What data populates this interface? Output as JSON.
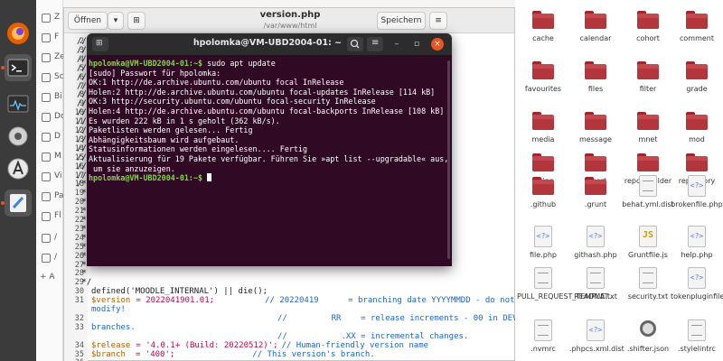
{
  "gedit": {
    "open_label": "Öffnen",
    "save_label": "Speichern",
    "title": "version.php",
    "subtitle": "/var/www/html"
  },
  "sidebar_left": {
    "items": [
      "Z",
      "F",
      "Ze",
      "Sc",
      "Bi",
      "Do",
      "D",
      "M",
      "Vi",
      "Pa",
      "Fl",
      "/",
      "/",
      "+ A"
    ]
  },
  "code": {
    "line_numbers": [
      "2",
      "3",
      "4",
      "5",
      "6",
      "7",
      "8",
      "9",
      "10",
      "11",
      "12",
      "13",
      "14",
      "15",
      "16",
      "17",
      "18",
      "19",
      "20",
      "21",
      "22",
      "23",
      "24",
      "25",
      "26",
      "27",
      "28",
      "29",
      "30",
      "31",
      "",
      "32",
      "33",
      "",
      "34",
      "35",
      "36"
    ],
    "partial_lines": [
      "//",
      "//",
      "//",
      "//",
      "//",
      "//",
      "//",
      "//",
      "//",
      "//",
      "//",
      "//",
      "//",
      "//",
      "//",
      "//",
      "/**",
      " *",
      " *",
      " *",
      " *",
      " *",
      " *",
      " *",
      " *",
      " *",
      " *",
      " */"
    ],
    "l30": "defined('MOODLE_INTERNAL') || die();",
    "l31_var": "$version",
    "l31_val": "= 2022041901.01;",
    "l31_com": "// 20220419      = branching date YYYYMMDD - do not",
    "l31b_com": "modify!",
    "l32_com": "//         RR    = release increments - 00 in DEV",
    "l32b_com": "branches.",
    "l33_com": "//           .XX = incremental changes.",
    "l34_var": "$release",
    "l34_val": "= '4.0.1+ (Build: 20220512)';",
    "l34_com": "// Human-friendly version name",
    "l35_var": "$branch",
    "l35_val": "= '400';",
    "l35_com": "// This version's branch."
  },
  "terminal": {
    "title": "hpolomka@VM-UBD2004-01: ~",
    "prompt": "hpolomka@VM-UBD2004-01:~$",
    "command": " sudo apt update",
    "lines": [
      "[sudo] Passwort für hpolomka:",
      "OK:1 http://de.archive.ubuntu.com/ubuntu focal InRelease",
      "Holen:2 http://de.archive.ubuntu.com/ubuntu focal-updates InRelease [114 kB]",
      "OK:3 http://security.ubuntu.com/ubuntu focal-security InRelease",
      "Holen:4 http://de.archive.ubuntu.com/ubuntu focal-backports InRelease [108 kB]",
      "Es wurden 222 kB in 1 s geholt (362 kB/s).",
      "Paketlisten werden gelesen... Fertig",
      "Abhängigkeitsbaum wird aufgebaut.",
      "Statusinformationen werden eingelesen.... Fertig",
      "Aktualisierung für 19 Pakete verfügbar. Führen Sie »apt list --upgradable« aus,",
      " um sie anzuzeigen."
    ]
  },
  "files": {
    "items": [
      {
        "name": "cache",
        "kind": "folder"
      },
      {
        "name": "calendar",
        "kind": "folder"
      },
      {
        "name": "cohort",
        "kind": "folder"
      },
      {
        "name": "comment",
        "kind": "folder"
      },
      {
        "name": "favourites",
        "kind": "folder"
      },
      {
        "name": "files",
        "kind": "folder"
      },
      {
        "name": "filter",
        "kind": "folder"
      },
      {
        "name": "grade",
        "kind": "folder"
      },
      {
        "name": "media",
        "kind": "folder"
      },
      {
        "name": "message",
        "kind": "folder"
      },
      {
        "name": "mnet",
        "kind": "folder"
      },
      {
        "name": "mod",
        "kind": "folder"
      },
      {
        "name": "rating",
        "kind": "folder"
      },
      {
        "name": "report",
        "kind": "folder"
      },
      {
        "name": "reportbuilder",
        "kind": "folder"
      },
      {
        "name": "repository",
        "kind": "folder"
      },
      {
        "name": ".github",
        "kind": "folder"
      },
      {
        "name": ".grunt",
        "kind": "folder"
      },
      {
        "name": "behat.yml.dist",
        "kind": "doc"
      },
      {
        "name": "brokenfile.php",
        "kind": "code"
      },
      {
        "name": "file.php",
        "kind": "code"
      },
      {
        "name": "githash.php",
        "kind": "code"
      },
      {
        "name": "Gruntfile.js",
        "kind": "js"
      },
      {
        "name": "help.php",
        "kind": "code"
      },
      {
        "name": "PULL_REQUEST_TEMPLAT...",
        "kind": "doc"
      },
      {
        "name": "README.txt",
        "kind": "doc"
      },
      {
        "name": "security.txt",
        "kind": "doc"
      },
      {
        "name": "tokenpluginfile.php",
        "kind": "code"
      },
      {
        "name": ".nvmrc",
        "kind": "doc"
      },
      {
        "name": ".phpcs.xml.dist",
        "kind": "code"
      },
      {
        "name": ".shifter.json",
        "kind": "gear"
      },
      {
        "name": ".stylelintrc",
        "kind": "doc"
      }
    ]
  }
}
